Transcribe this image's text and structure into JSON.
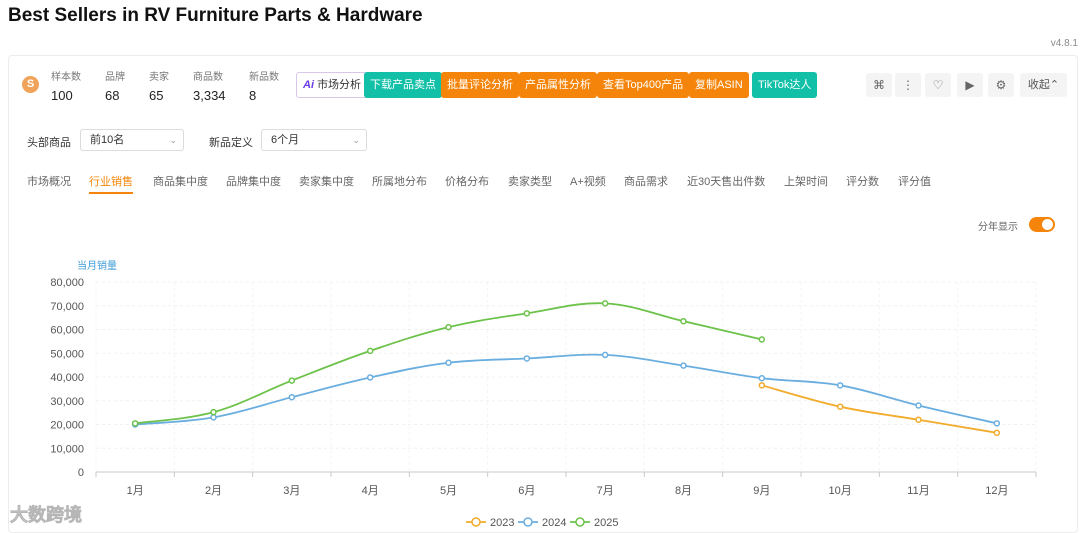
{
  "page": {
    "title": "Best Sellers in RV Furniture Parts & Hardware",
    "version": "v4.8.1"
  },
  "stats": [
    {
      "label": "样本数",
      "value": "100"
    },
    {
      "label": "品牌",
      "value": "68"
    },
    {
      "label": "卖家",
      "value": "65"
    },
    {
      "label": "商品数",
      "value": "3,334"
    },
    {
      "label": "新品数",
      "value": "8"
    }
  ],
  "brand_logo": {
    "icon": "sellersprite-logo-icon",
    "glyph": "S"
  },
  "actions": {
    "ai": {
      "prefix": "Ai",
      "label": "市场分析"
    },
    "download": "下载产品卖点",
    "review": "批量评论分析",
    "attributes": "产品属性分析",
    "top400": "查看Top400产品",
    "copy_asin": "复制ASIN",
    "tiktok": "TikTok达人"
  },
  "tools": [
    {
      "name": "apps-icon",
      "glyph": "⌘"
    },
    {
      "name": "more-icon",
      "glyph": "⋮"
    },
    {
      "name": "heart-icon",
      "glyph": "♡"
    },
    {
      "name": "video-icon",
      "glyph": "▶"
    },
    {
      "name": "gear-icon",
      "glyph": "⚙"
    }
  ],
  "collapse_label": "收起",
  "collapse_caret": "⌃",
  "filters": {
    "head_label": "头部商品",
    "head_value": "前10名",
    "new_label": "新品定义",
    "new_value": "6个月",
    "caret": "⌄"
  },
  "tabs": [
    "市场概况",
    "行业销售",
    "商品集中度",
    "品牌集中度",
    "卖家集中度",
    "所属地分布",
    "价格分布",
    "卖家类型",
    "A+视频",
    "商品需求",
    "近30天售出件数",
    "上架时间",
    "评分数",
    "评分值"
  ],
  "active_tab": 1,
  "toggle_label": "分年显示",
  "toggle_on": true,
  "watermark": "大数跨境",
  "colors": {
    "accent": "#f5850a",
    "teal": "#11c0a6",
    "s2023": "#f2ab2a",
    "s2024": "#6aaee0",
    "s2025": "#6cc24a",
    "axis_label": "#3d9bd6"
  },
  "chart_data": {
    "type": "line",
    "ylabel": "当月销量",
    "ylim": [
      0,
      80000
    ],
    "yticks": [
      0,
      10000,
      20000,
      30000,
      40000,
      50000,
      60000,
      70000,
      80000
    ],
    "ytick_labels": [
      "0",
      "10,000",
      "20,000",
      "30,000",
      "40,000",
      "50,000",
      "60,000",
      "70,000",
      "80,000"
    ],
    "categories": [
      "1月",
      "2月",
      "3月",
      "4月",
      "5月",
      "6月",
      "7月",
      "8月",
      "9月",
      "10月",
      "11月",
      "12月"
    ],
    "grid": true,
    "legend_position": "bottom-center",
    "series": [
      {
        "name": "2023",
        "values": [
          null,
          null,
          null,
          null,
          null,
          null,
          null,
          null,
          36500,
          27500,
          22000,
          16500
        ]
      },
      {
        "name": "2024",
        "values": [
          20000,
          23000,
          31500,
          39800,
          46000,
          47800,
          49300,
          44800,
          39500,
          36500,
          28000,
          20500
        ]
      },
      {
        "name": "2025",
        "values": [
          20500,
          25200,
          38500,
          51000,
          61000,
          66800,
          71000,
          63500,
          55800,
          null,
          null,
          null
        ]
      }
    ]
  }
}
